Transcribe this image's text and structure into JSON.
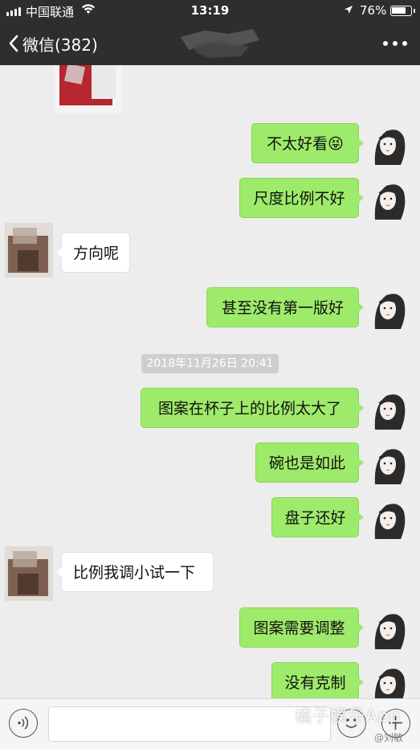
{
  "status_bar": {
    "carrier": "中国联通",
    "time": "13:19",
    "battery_percent": "76%",
    "battery_level": 0.76
  },
  "nav": {
    "back_label": "微信(382)",
    "contact_name_redacted": true
  },
  "messages": [
    {
      "side": "out",
      "text": "不太好看😝"
    },
    {
      "side": "out",
      "text": "尺度比例不好"
    },
    {
      "side": "in",
      "text": "方向呢"
    },
    {
      "side": "out",
      "text": "甚至没有第一版好"
    },
    {
      "side": "timestamp",
      "text": "2018年11月26日 20:41"
    },
    {
      "side": "out",
      "text": "图案在杯子上的比例太大了"
    },
    {
      "side": "out",
      "text": "碗也是如此"
    },
    {
      "side": "out",
      "text": "盘子还好"
    },
    {
      "side": "in",
      "text": "比例我调小试一下"
    },
    {
      "side": "out",
      "text": "图案需要调整"
    },
    {
      "side": "out",
      "text": "没有克制"
    }
  ],
  "input": {
    "placeholder": ""
  },
  "watermark": {
    "text": "橘子娱乐App",
    "sub": "@刘敏"
  },
  "colors": {
    "nav_bg": "#2e2e2e",
    "chat_bg": "#ededed",
    "outgoing_bubble": "#9eea6a",
    "incoming_bubble": "#ffffff"
  },
  "icons": [
    "chevron-left-icon",
    "more-dots-icon",
    "voice-icon",
    "emoji-icon",
    "plus-icon",
    "wifi-icon",
    "location-arrow-icon",
    "battery-icon",
    "signal-icon"
  ]
}
